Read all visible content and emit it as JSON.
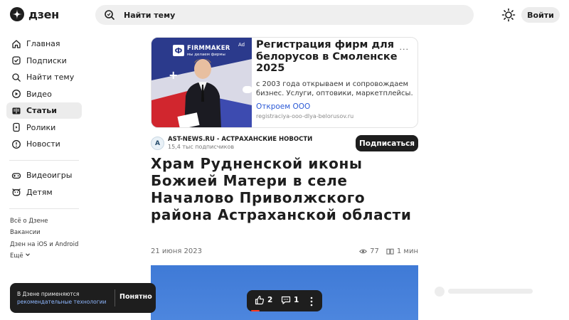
{
  "header": {
    "logo_text": "дзен",
    "search_placeholder": "Найти тему",
    "login_label": "Войти"
  },
  "sidebar": {
    "items": [
      {
        "label": "Главная",
        "icon": "home-icon"
      },
      {
        "label": "Подписки",
        "icon": "subscriptions-icon"
      },
      {
        "label": "Найти тему",
        "icon": "search-icon"
      },
      {
        "label": "Видео",
        "icon": "video-icon"
      },
      {
        "label": "Статьи",
        "icon": "articles-icon",
        "active": true
      },
      {
        "label": "Ролики",
        "icon": "clips-icon"
      },
      {
        "label": "Новости",
        "icon": "news-icon"
      }
    ],
    "extra": [
      {
        "label": "Видеоигры",
        "icon": "gamepad-icon"
      },
      {
        "label": "Детям",
        "icon": "kids-icon"
      }
    ],
    "footer_links": [
      "Всё о Дзене",
      "Вакансии",
      "Дзен на iOS и Android"
    ],
    "more_label": "Ещё"
  },
  "ad": {
    "brand": "FIRMMAKER",
    "brand_tagline": "мы делаем фирмы",
    "ad_label": "Ad",
    "title": "Регистрация фирм для белорусов в Смоленске 2025",
    "text": "с 2003 года открываем и сопровождаем бизнес. Услуги, оптовики, маркетплейсы.",
    "cta": "Откроем ООО",
    "url": "registraciya-ooo-dlya-belorusov.ru",
    "menu": "···"
  },
  "channel": {
    "avatar_letter": "А",
    "name": "AST-NEWS.RU - АСТРАХАНСКИЕ НОВОСТИ",
    "subscribers": "15,4 тыс подписчиков",
    "subscribe_label": "Подписаться"
  },
  "article": {
    "title": "Храм Рудненской иконы Божией Матери в селе Началово Приволжского района Астраханской области",
    "date": "21 июня 2023",
    "views": "77",
    "read_time": "1 мин"
  },
  "cookie": {
    "text_line1": "В Дзене применяются",
    "text_link": "рекомендательные технологии",
    "button": "Понятно"
  },
  "reactions": {
    "likes": "2",
    "comments": "1"
  },
  "colors": {
    "accent_dark": "#1e1e1e",
    "link_blue": "#2c5ad6",
    "like_red": "#ff3b1f"
  }
}
